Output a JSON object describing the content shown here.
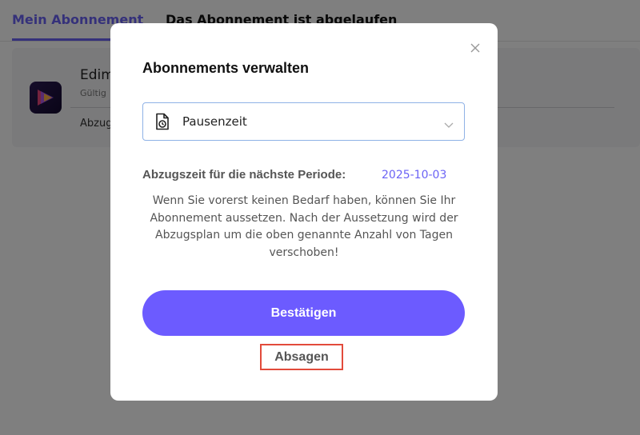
{
  "tabs": [
    {
      "label": "Mein Abonnement",
      "active": true
    },
    {
      "label": "Das Abonnement ist abgelaufen",
      "active": false
    }
  ],
  "subscription_card": {
    "app_name": "Edim",
    "validity_label": "Gültig",
    "deduction_label": "Abzug"
  },
  "modal": {
    "title": "Abonnements verwalten",
    "select": {
      "value": "Pausenzeit",
      "icon": "document-clock-icon"
    },
    "deduct_label": "Abzugszeit für die nächste Periode:",
    "deduct_date": "2025-10-03",
    "description": "Wenn Sie vorerst keinen Bedarf haben, können Sie Ihr Abonnement aussetzen. Nach der Aussetzung wird der Abzugsplan um die oben genannte Anzahl von Tagen verschoben!",
    "confirm_label": "Bestätigen",
    "cancel_label": "Absagen"
  },
  "colors": {
    "accent": "#6b63f5",
    "primary_button": "#6c5bff",
    "highlight_border": "#e24b3b"
  }
}
